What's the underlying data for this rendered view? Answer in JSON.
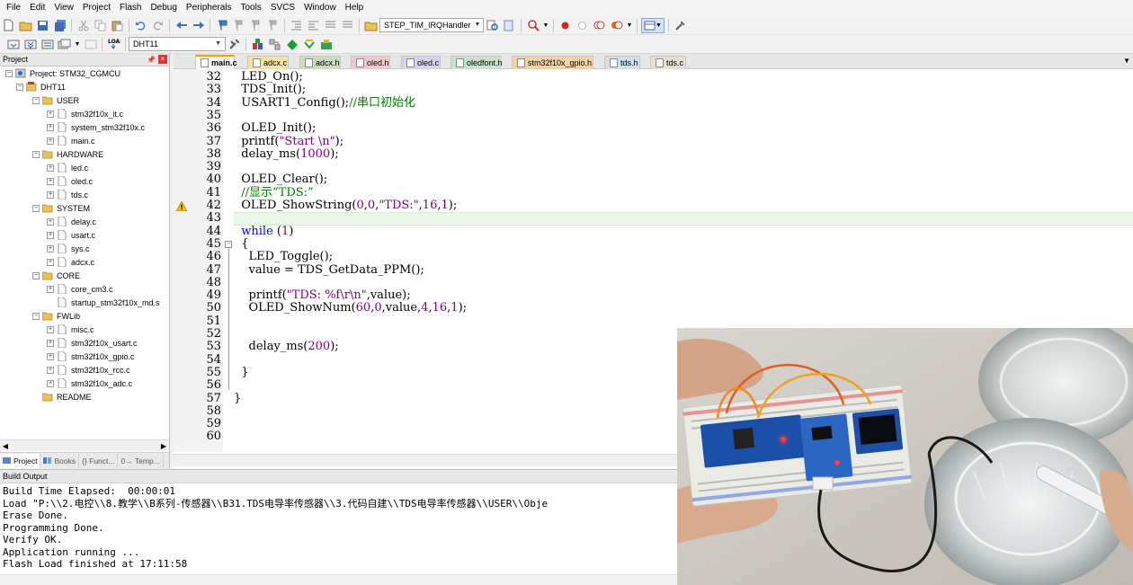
{
  "menu": [
    "File",
    "Edit",
    "View",
    "Project",
    "Flash",
    "Debug",
    "Peripherals",
    "Tools",
    "SVCS",
    "Window",
    "Help"
  ],
  "toolbar": {
    "function_combo": "STEP_TIM_IRQHandler",
    "target_combo": "DHT11"
  },
  "project_panel": {
    "title": "Project",
    "tree": [
      {
        "label": "Project: STM32_CGMCU",
        "level": 0,
        "kind": "project",
        "expander": "minus"
      },
      {
        "label": "DHT11",
        "level": 1,
        "kind": "target",
        "expander": "minus"
      },
      {
        "label": "USER",
        "level": 2,
        "kind": "folder",
        "expander": "minus"
      },
      {
        "label": "stm32f10x_it.c",
        "level": 3,
        "kind": "file",
        "expander": "plus"
      },
      {
        "label": "system_stm32f10x.c",
        "level": 3,
        "kind": "file",
        "expander": "plus"
      },
      {
        "label": "main.c",
        "level": 3,
        "kind": "file",
        "expander": "plus"
      },
      {
        "label": "HARDWARE",
        "level": 2,
        "kind": "folder",
        "expander": "minus"
      },
      {
        "label": "led.c",
        "level": 3,
        "kind": "file",
        "expander": "plus"
      },
      {
        "label": "oled.c",
        "level": 3,
        "kind": "file",
        "expander": "plus"
      },
      {
        "label": "tds.c",
        "level": 3,
        "kind": "file",
        "expander": "plus"
      },
      {
        "label": "SYSTEM",
        "level": 2,
        "kind": "folder",
        "expander": "minus"
      },
      {
        "label": "delay.c",
        "level": 3,
        "kind": "file",
        "expander": "plus"
      },
      {
        "label": "usart.c",
        "level": 3,
        "kind": "file",
        "expander": "plus"
      },
      {
        "label": "sys.c",
        "level": 3,
        "kind": "file",
        "expander": "plus"
      },
      {
        "label": "adcx.c",
        "level": 3,
        "kind": "file",
        "expander": "plus"
      },
      {
        "label": "CORE",
        "level": 2,
        "kind": "folder",
        "expander": "minus"
      },
      {
        "label": "core_cm3.c",
        "level": 3,
        "kind": "file",
        "expander": "plus"
      },
      {
        "label": "startup_stm32f10x_md.s",
        "level": 3,
        "kind": "file",
        "expander": "none"
      },
      {
        "label": "FWLib",
        "level": 2,
        "kind": "folder",
        "expander": "minus"
      },
      {
        "label": "misc.c",
        "level": 3,
        "kind": "file",
        "expander": "plus"
      },
      {
        "label": "stm32f10x_usart.c",
        "level": 3,
        "kind": "file",
        "expander": "plus"
      },
      {
        "label": "stm32f10x_gpio.c",
        "level": 3,
        "kind": "file",
        "expander": "plus"
      },
      {
        "label": "stm32f10x_rcc.c",
        "level": 3,
        "kind": "file",
        "expander": "plus"
      },
      {
        "label": "stm32f10x_adc.c",
        "level": 3,
        "kind": "file",
        "expander": "plus"
      },
      {
        "label": "README",
        "level": 2,
        "kind": "folder",
        "expander": "none"
      }
    ],
    "bottom_tabs": [
      "Project",
      "Books",
      "{} Funct...",
      "0→ Temp..."
    ]
  },
  "editor_tabs": [
    {
      "label": "main.c",
      "active": true,
      "color": "#f9f9f9"
    },
    {
      "label": "adcx.c",
      "active": false,
      "color": "#f5e3a5"
    },
    {
      "label": "adcx.h",
      "active": false,
      "color": "#cbdcc0"
    },
    {
      "label": "oled.h",
      "active": false,
      "color": "#f2c8cf"
    },
    {
      "label": "oled.c",
      "active": false,
      "color": "#d9d2ee"
    },
    {
      "label": "oledfont.h",
      "active": false,
      "color": "#c9e2cf"
    },
    {
      "label": "stm32f10x_gpio.h",
      "active": false,
      "color": "#f3d3a6"
    },
    {
      "label": "tds.h",
      "active": false,
      "color": "#cfdff0"
    },
    {
      "label": "tds.c",
      "active": false,
      "color": "#e5e1d2"
    }
  ],
  "code": {
    "first_line": 32,
    "current_line": 43,
    "warning_line": 42,
    "lines": [
      [
        {
          "t": "  LED_On();"
        }
      ],
      [
        {
          "t": "  TDS_Init();"
        }
      ],
      [
        {
          "t": "  USART1_Config();"
        },
        {
          "t": "//串口初始化",
          "c": "cmt"
        }
      ],
      [
        {
          "t": ""
        }
      ],
      [
        {
          "t": "  OLED_Init();"
        }
      ],
      [
        {
          "t": "  printf("
        },
        {
          "t": "\"Start \\n\"",
          "c": "str"
        },
        {
          "t": ");"
        }
      ],
      [
        {
          "t": "  delay_ms("
        },
        {
          "t": "1000",
          "c": "num"
        },
        {
          "t": ");"
        }
      ],
      [
        {
          "t": ""
        }
      ],
      [
        {
          "t": "  OLED_Clear();"
        }
      ],
      [
        {
          "t": "  //显示“TDS:”",
          "c": "cmt"
        }
      ],
      [
        {
          "t": "  OLED_ShowString("
        },
        {
          "t": "0",
          "c": "num"
        },
        {
          "t": ","
        },
        {
          "t": "0",
          "c": "num"
        },
        {
          "t": ","
        },
        {
          "t": "\"TDS:\"",
          "c": "str"
        },
        {
          "t": ","
        },
        {
          "t": "16",
          "c": "num"
        },
        {
          "t": ","
        },
        {
          "t": "1",
          "c": "num"
        },
        {
          "t": ");"
        }
      ],
      [
        {
          "t": ""
        }
      ],
      [
        {
          "t": "  "
        },
        {
          "t": "while",
          "c": "kw"
        },
        {
          "t": " ("
        },
        {
          "t": "1",
          "c": "num"
        },
        {
          "t": ")"
        }
      ],
      [
        {
          "t": "  {"
        }
      ],
      [
        {
          "t": "    LED_Toggle();"
        }
      ],
      [
        {
          "t": "    value = TDS_GetData_PPM();"
        }
      ],
      [
        {
          "t": ""
        }
      ],
      [
        {
          "t": "    printf("
        },
        {
          "t": "\"TDS: %f\\r\\n\"",
          "c": "str"
        },
        {
          "t": ",value);"
        }
      ],
      [
        {
          "t": "    OLED_ShowNum("
        },
        {
          "t": "60",
          "c": "num"
        },
        {
          "t": ","
        },
        {
          "t": "0",
          "c": "num"
        },
        {
          "t": ",value,"
        },
        {
          "t": "4",
          "c": "num"
        },
        {
          "t": ","
        },
        {
          "t": "16",
          "c": "num"
        },
        {
          "t": ","
        },
        {
          "t": "1",
          "c": "num"
        },
        {
          "t": ");"
        }
      ],
      [
        {
          "t": ""
        }
      ],
      [
        {
          "t": ""
        }
      ],
      [
        {
          "t": "    delay_ms("
        },
        {
          "t": "200",
          "c": "num"
        },
        {
          "t": ");"
        }
      ],
      [
        {
          "t": ""
        }
      ],
      [
        {
          "t": "  }"
        }
      ],
      [
        {
          "t": ""
        }
      ],
      [
        {
          "t": "}"
        }
      ],
      [
        {
          "t": ""
        }
      ],
      [
        {
          "t": ""
        }
      ],
      [
        {
          "t": ""
        }
      ]
    ]
  },
  "build_output": {
    "title": "Build Output",
    "lines": [
      "Build Time Elapsed:  00:00:01",
      "Load \"P:\\\\2.电控\\\\8.教学\\\\B系列-传感器\\\\B31.TDS电导率传感器\\\\3.代码自建\\\\TDS电导率传感器\\\\USER\\\\Obje",
      "Erase Done.",
      "Programming Done.",
      "Verify OK.",
      "Application running ...",
      "Flash Load finished at 17:11:58"
    ]
  }
}
